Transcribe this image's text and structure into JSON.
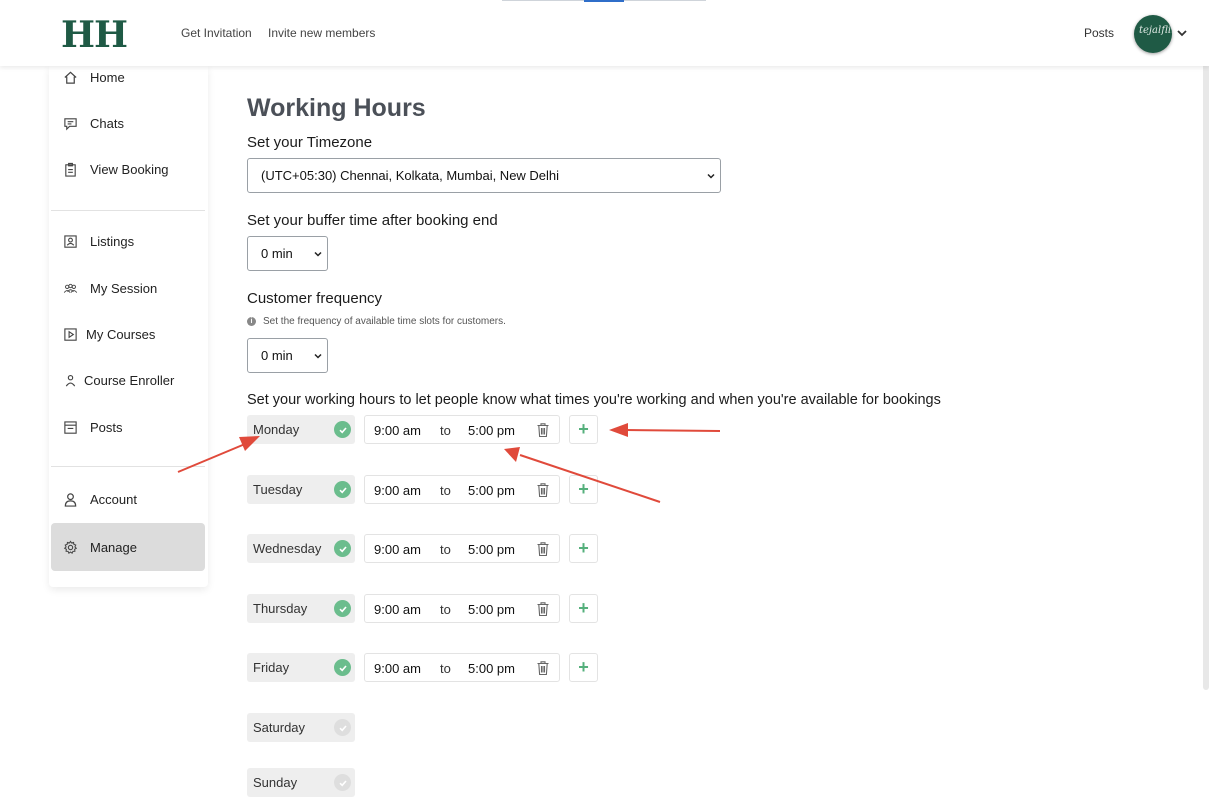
{
  "header": {
    "logo": "HH",
    "links": [
      "Get Invitation",
      "Invite new members"
    ],
    "posts": "Posts"
  },
  "sidebar": {
    "items": [
      {
        "label": "Home",
        "icon": "home-icon"
      },
      {
        "label": "Chats",
        "icon": "chat-icon"
      },
      {
        "label": "View Booking",
        "icon": "clipboard-icon"
      },
      {
        "label": "Listings",
        "icon": "id-card-icon"
      },
      {
        "label": "My Session",
        "icon": "users-icon"
      },
      {
        "label": "My Courses",
        "icon": "play-box-icon"
      },
      {
        "label": "Course Enroller",
        "icon": "person-icon"
      },
      {
        "label": "Posts",
        "icon": "posts-icon"
      },
      {
        "label": "Account",
        "icon": "account-icon"
      },
      {
        "label": "Manage",
        "icon": "gear-icon"
      }
    ],
    "active": "Manage"
  },
  "main": {
    "title": "Working Hours",
    "timezone_label": "Set your Timezone",
    "timezone_value": "(UTC+05:30) Chennai, Kolkata, Mumbai, New Delhi",
    "buffer_label": "Set your buffer time after booking end",
    "buffer_value": "0 min",
    "frequency_label": "Customer frequency",
    "frequency_hint": "Set the frequency of available time slots for customers.",
    "frequency_value": "0 min",
    "hours_label": "Set your working hours to let people know what times you're working and when you're available for bookings",
    "to_label": "to",
    "days": [
      {
        "name": "Monday",
        "enabled": true,
        "start": "9:00 am",
        "end": "5:00 pm"
      },
      {
        "name": "Tuesday",
        "enabled": true,
        "start": "9:00 am",
        "end": "5:00 pm"
      },
      {
        "name": "Wednesday",
        "enabled": true,
        "start": "9:00 am",
        "end": "5:00 pm"
      },
      {
        "name": "Thursday",
        "enabled": true,
        "start": "9:00 am",
        "end": "5:00 pm"
      },
      {
        "name": "Friday",
        "enabled": true,
        "start": "9:00 am",
        "end": "5:00 pm"
      },
      {
        "name": "Saturday",
        "enabled": false
      },
      {
        "name": "Sunday",
        "enabled": false
      }
    ]
  },
  "colors": {
    "brand": "#1f5a45",
    "check_on": "#6bbd8d",
    "plus": "#55b07c",
    "annotation_arrow": "#e04a3b",
    "active_nav": "#dcdcdc"
  }
}
